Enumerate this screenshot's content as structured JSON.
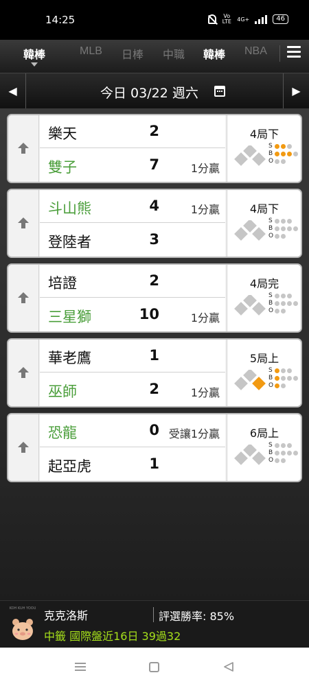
{
  "status_bar": {
    "time": "14:25",
    "network": "4G+",
    "battery": "46"
  },
  "sport_tabs": {
    "items": [
      {
        "label": "韓棒",
        "active": true
      },
      {
        "label": "MLB",
        "active": false
      },
      {
        "label": "日棒",
        "active": false
      },
      {
        "label": "中職",
        "active": false
      },
      {
        "label": "韓棒",
        "active": true
      },
      {
        "label": "NBA",
        "active": false
      }
    ],
    "menu_icon": "hamburger-icon"
  },
  "date_bar": {
    "label": "今日 03/22 週六",
    "prev_icon": "triangle-left-icon",
    "next_icon": "triangle-right-icon",
    "calendar_icon": "calendar-icon"
  },
  "games": [
    {
      "away": {
        "name": "樂天",
        "score": "2",
        "result": "",
        "winner": false
      },
      "home": {
        "name": "雙子",
        "score": "7",
        "result": "1分贏",
        "winner": true
      },
      "inning": "4局下",
      "bases": {
        "first": false,
        "second": false,
        "third": false
      },
      "count": {
        "strikes": 2,
        "balls": 3,
        "outs": 0
      }
    },
    {
      "away": {
        "name": "斗山熊",
        "score": "4",
        "result": "1分贏",
        "winner": true
      },
      "home": {
        "name": "登陸者",
        "score": "3",
        "result": "",
        "winner": false
      },
      "inning": "4局下",
      "bases": {
        "first": false,
        "second": false,
        "third": false
      },
      "count": {
        "strikes": 0,
        "balls": 0,
        "outs": 0
      }
    },
    {
      "away": {
        "name": "培證",
        "score": "2",
        "result": "",
        "winner": false
      },
      "home": {
        "name": "三星獅",
        "score": "10",
        "result": "1分贏",
        "winner": true
      },
      "inning": "4局完",
      "bases": {
        "first": false,
        "second": false,
        "third": false
      },
      "count": {
        "strikes": 0,
        "balls": 0,
        "outs": 0
      }
    },
    {
      "away": {
        "name": "華老鷹",
        "score": "1",
        "result": "",
        "winner": false
      },
      "home": {
        "name": "巫師",
        "score": "2",
        "result": "1分贏",
        "winner": true
      },
      "inning": "5局上",
      "bases": {
        "first": true,
        "second": false,
        "third": false
      },
      "count": {
        "strikes": 1,
        "balls": 1,
        "outs": 1
      }
    },
    {
      "away": {
        "name": "恐龍",
        "score": "0",
        "result": "受讓1分贏",
        "winner": true
      },
      "home": {
        "name": "起亞虎",
        "score": "1",
        "result": "",
        "winner": false
      },
      "inning": "6局上",
      "bases": {
        "first": false,
        "second": false,
        "third": false
      },
      "count": {
        "strikes": 0,
        "balls": 0,
        "outs": 0
      }
    }
  ],
  "sbo_labels": {
    "s": "S",
    "b": "B",
    "o": "O"
  },
  "banner": {
    "avatar_caption": "KOH KUH YOOU",
    "tipster": "克克洛斯",
    "win_rate": "評選勝率: 85%",
    "record": "中籤 國際盤近16日 39過32"
  },
  "colors": {
    "accent_orange": "#f29a12",
    "win_green": "#4a9e3a",
    "record_lime": "#a6e01b",
    "base_gray": "#c6c6c6"
  }
}
